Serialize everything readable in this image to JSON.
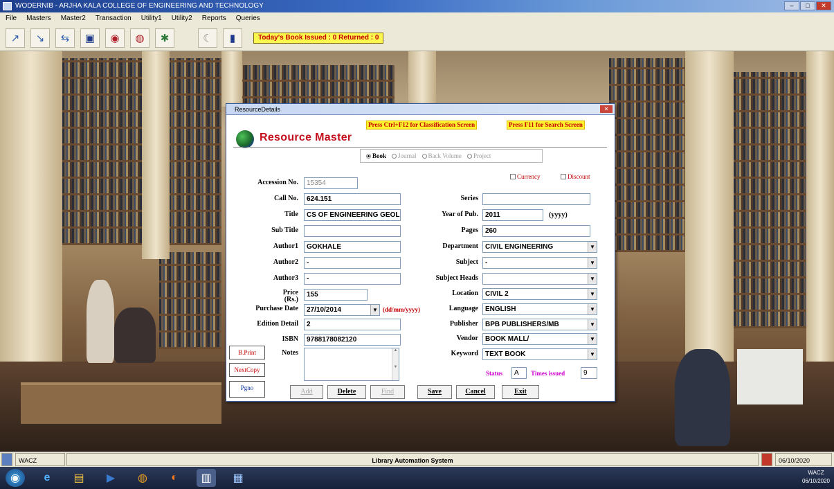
{
  "window": {
    "title": "WODERNIB - ARJHA KALA COLLEGE OF ENGINEERING AND TECHNOLOGY",
    "min": "–",
    "max": "□",
    "close": "✕"
  },
  "menu": [
    "File",
    "Masters",
    "Master2",
    "Transaction",
    "Utility1",
    "Utility2",
    "Reports",
    "Queries"
  ],
  "toolbar": {
    "icons": [
      "move-icon",
      "resize-icon",
      "return-icon",
      "monitor-icon",
      "cd-icon",
      "globe-icon",
      "tools-icon",
      "moon-icon",
      "help-book-icon"
    ],
    "glyphs": [
      "↗",
      "↘",
      "⇆",
      "▣",
      "◉",
      "◍",
      "✱",
      "☾",
      "▮"
    ],
    "today_label": "Today's Book Issued : 0 Returned : 0"
  },
  "dialog": {
    "title": "ResourceDetails",
    "close": "✕",
    "hint_left": "Press Ctrl+F12 for Classification Screen",
    "hint_right": "Press F11 for Search Screen",
    "heading": "Resource Master",
    "radios": [
      {
        "label": "Book",
        "selected": true
      },
      {
        "label": "Journal",
        "selected": false
      },
      {
        "label": "Back Volume",
        "selected": false
      },
      {
        "label": "Project",
        "selected": false
      }
    ],
    "accession": {
      "label": "Accession No.",
      "value": "15354"
    },
    "checkboxes": {
      "currency": "Currency",
      "discount": "Discount"
    },
    "left_fields": [
      {
        "label": "Call No.",
        "value": "624.151"
      },
      {
        "label": "Title",
        "value": "CS OF ENGINEERING GEOLOGY"
      },
      {
        "label": "Sub Title",
        "value": ""
      },
      {
        "label": "Author1",
        "value": "GOKHALE"
      },
      {
        "label": "Author2",
        "value": "-"
      },
      {
        "label": "Author3",
        "value": "-"
      },
      {
        "label": "Price",
        "value": "155"
      },
      {
        "label": "Purchase Date",
        "value": "27/10/2014"
      },
      {
        "label": "Edition Detail",
        "value": "2"
      },
      {
        "label": "ISBN",
        "value": "9788178082120"
      },
      {
        "label": "Notes",
        "value": ""
      }
    ],
    "price_unit": "(Rs.)",
    "purchase_note": "(dd/mm/yyyy)",
    "right_fields": [
      {
        "label": "Series",
        "value": "",
        "combo": false
      },
      {
        "label": "Year of Pub.",
        "value": "2011",
        "combo": false
      },
      {
        "label": "Pages",
        "value": "260",
        "combo": false
      },
      {
        "label": "Department",
        "value": "CIVIL ENGINEERING",
        "combo": true
      },
      {
        "label": "Subject",
        "value": "-",
        "combo": true
      },
      {
        "label": "Subject Heads",
        "value": "",
        "combo": true
      },
      {
        "label": "Location",
        "value": "CIVIL 2",
        "combo": true
      },
      {
        "label": "Language",
        "value": "ENGLISH",
        "combo": true
      },
      {
        "label": "Publisher",
        "value": "BPB PUBLISHERS/MB",
        "combo": true
      },
      {
        "label": "Vendor",
        "value": "BOOK MALL/",
        "combo": true
      },
      {
        "label": "Keyword",
        "value": "TEXT BOOK",
        "combo": true
      }
    ],
    "year_unit": "(yyyy)",
    "status": {
      "label": "Status",
      "value": "A",
      "times_label": "Times issued",
      "times_value": "9"
    },
    "side_buttons": [
      "B.Print",
      "NextCopy",
      "Pgno"
    ],
    "buttons": [
      {
        "label": "Add",
        "enabled": false
      },
      {
        "label": "Delete",
        "enabled": true
      },
      {
        "label": "Find",
        "enabled": false
      },
      {
        "label": "Save",
        "enabled": true
      },
      {
        "label": "Cancel",
        "enabled": true
      },
      {
        "label": "Exit",
        "enabled": true
      }
    ]
  },
  "statusbar": {
    "left": "WACZ",
    "center": "Library Automation System",
    "right": "06/10/2020"
  },
  "taskbar": {
    "icons": [
      "start-orb-icon",
      "ie-icon",
      "explorer-icon",
      "media-icon",
      "chrome-icon",
      "firefox-icon",
      "library-app-icon",
      "window-icon"
    ],
    "glyphs": [
      "◉",
      "e",
      "▤",
      "▶",
      "◍",
      "◐",
      "▥",
      "▦"
    ],
    "tray_top": "WACZ",
    "tray_bottom": "06/10/2020"
  },
  "colors": {
    "title_blue": "#1e3f8e",
    "hint_yellow": "#fff22e",
    "heading_red": "#c4101c"
  }
}
